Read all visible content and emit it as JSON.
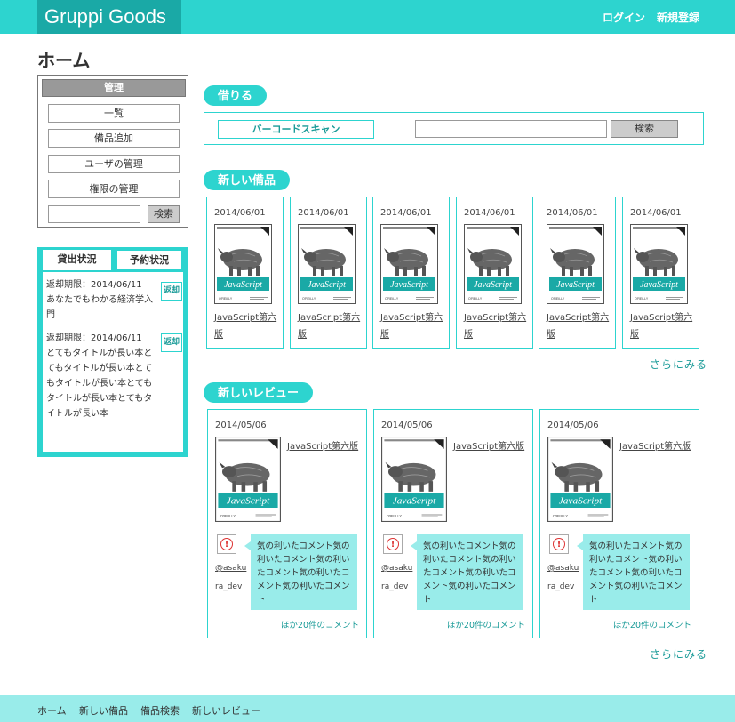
{
  "header": {
    "brand": "Gruppi Goods",
    "login": "ログイン",
    "signup": "新規登録"
  },
  "page_title": "ホーム",
  "admin": {
    "heading": "管理",
    "items": [
      "一覧",
      "備品追加",
      "ユーザの管理",
      "権限の管理"
    ],
    "search_label": "検索",
    "search_value": ""
  },
  "loan": {
    "tabs": [
      "貸出状況",
      "予約状況"
    ],
    "entries": [
      {
        "lines": [
          "返却期限：2014/06/11",
          "あなたでもわかる経済学入",
          "門"
        ],
        "button": "返却"
      },
      {
        "lines": [
          "返却期限：2014/06/11",
          "とてもタイトルが長い本と",
          "てもタイトルが長い本とて",
          "もタイトルが長い本とても",
          "タイトルが長い本とてもタ",
          "イトルが長い本"
        ],
        "button": "返却"
      }
    ]
  },
  "borrow": {
    "heading": "借りる",
    "barcode_label": "バーコードスキャン",
    "search_value": "",
    "search_label": "検索"
  },
  "new_items": {
    "heading": "新しい備品",
    "cards": [
      {
        "date": "2014/06/01",
        "title_line1": "JavaScript第六",
        "title_line2": "版"
      },
      {
        "date": "2014/06/01",
        "title_line1": "JavaScript第六",
        "title_line2": "版"
      },
      {
        "date": "2014/06/01",
        "title_line1": "JavaScript第六",
        "title_line2": "版"
      },
      {
        "date": "2014/06/01",
        "title_line1": "JavaScript第六",
        "title_line2": "版"
      },
      {
        "date": "2014/06/01",
        "title_line1": "JavaScript第六",
        "title_line2": "版"
      },
      {
        "date": "2014/06/01",
        "title_line1": "JavaScript第六",
        "title_line2": "版"
      }
    ],
    "more": "さらにみる"
  },
  "reviews": {
    "heading": "新しいレビュー",
    "cards": [
      {
        "date": "2014/05/06",
        "title": "JavaScript第六版",
        "user_line1": "@asaku",
        "user_line2": "ra_dev",
        "comment": [
          "気の利いたコメント気の",
          "利いたコメント気の利い",
          "たコメント気の利いたコ",
          "メント気の利いたコメン",
          "ト"
        ],
        "more_comments": "ほか20件のコメント"
      },
      {
        "date": "2014/05/06",
        "title": "JavaScript第六版",
        "user_line1": "@asaku",
        "user_line2": "ra_dev",
        "comment": [
          "気の利いたコメント気の",
          "利いたコメント気の利い",
          "たコメント気の利いたコ",
          "メント気の利いたコメン",
          "ト"
        ],
        "more_comments": "ほか20件のコメント"
      },
      {
        "date": "2014/05/06",
        "title": "JavaScript第六版",
        "user_line1": "@asaku",
        "user_line2": "ra_dev",
        "comment": [
          "気の利いたコメント気の",
          "利いたコメント気の利い",
          "たコメント気の利いたコ",
          "メント気の利いたコメン",
          "ト"
        ],
        "more_comments": "ほか20件のコメント"
      }
    ],
    "more": "さらにみる"
  },
  "cover": {
    "brand": "JavaScript",
    "publisher": "O'REILLY"
  },
  "footer": {
    "links": [
      "ホーム",
      "新しい備品",
      "備品検索",
      "新しいレビュー"
    ]
  },
  "colors": {
    "accent": "#2dd4cf",
    "accent_dark": "#1aa9a6",
    "accent_light": "#99ecea",
    "warning": "#dd3333"
  }
}
